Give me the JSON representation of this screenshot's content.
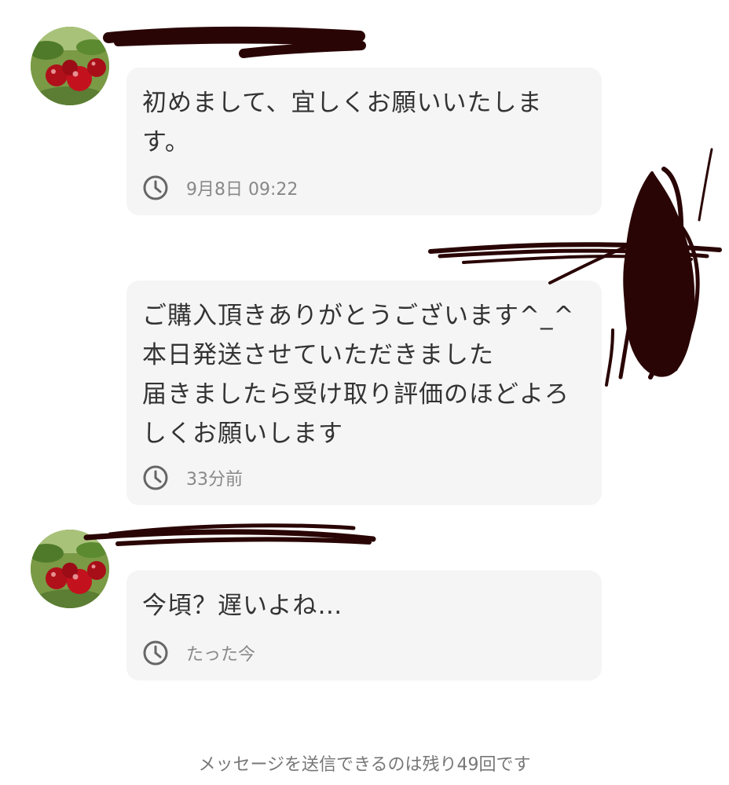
{
  "conversation": {
    "messages": [
      {
        "sender_avatar": "lingonberry-photo",
        "text": "初めまして、宜しくお願いいたしま\nす。",
        "time": "9月8日 09:22"
      },
      {
        "sender_avatar": "",
        "text": "ご購入頂きありがとうございます^_^\n本日発送させていただきました\n届きましたら受け取り評価のほどよろ\nしくお願いします",
        "time": "33分前"
      },
      {
        "sender_avatar": "lingonberry-photo",
        "text": "今頃？遅いよね…",
        "time": "たった今"
      }
    ],
    "remaining_note": "メッセージを送信できるのは残り49回です"
  },
  "icons": {
    "clock": "clock-icon",
    "avatar": "avatar-berries-image"
  },
  "colors": {
    "bubble_bg": "#f5f5f5",
    "text": "#333333",
    "meta_text": "#888888",
    "redaction_ink": "#2a0505"
  }
}
